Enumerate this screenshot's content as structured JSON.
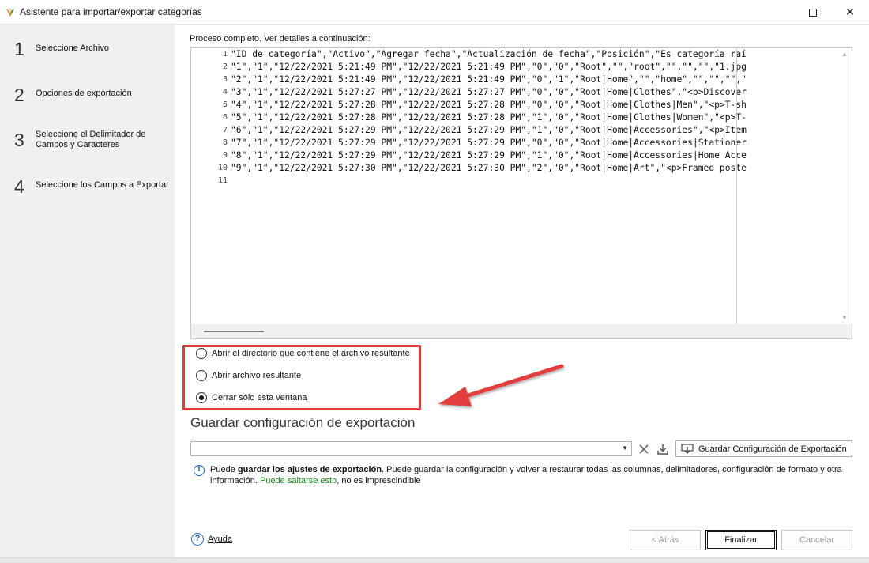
{
  "window": {
    "title": "Asistente para importar/exportar categorías",
    "maximize_glyph": "□",
    "close_glyph": "✕"
  },
  "steps": [
    {
      "num": "1",
      "label": "Seleccione Archivo"
    },
    {
      "num": "2",
      "label": "Opciones de exportación"
    },
    {
      "num": "3",
      "label": "Seleccione el Delimitador de Campos y Caracteres"
    },
    {
      "num": "4",
      "label": "Seleccione los Campos a Exportar"
    }
  ],
  "main": {
    "process_label": "Proceso completo. Ver detalles a continuación:",
    "line_numbers": [
      "1",
      "2",
      "3",
      "4",
      "5",
      "6",
      "7",
      "8",
      "9",
      "10",
      "11"
    ],
    "code_lines": [
      "\"ID de categoría\",\"Activo\",\"Agregar fecha\",\"Actualización de fecha\",\"Posición\",\"Es categoría raí",
      "\"1\",\"1\",\"12/22/2021 5:21:49 PM\",\"12/22/2021 5:21:49 PM\",\"0\",\"0\",\"Root\",\"\",\"root\",\"\",\"\",\"\",\"1.jpg",
      "\"2\",\"1\",\"12/22/2021 5:21:49 PM\",\"12/22/2021 5:21:49 PM\",\"0\",\"1\",\"Root|Home\",\"\",\"home\",\"\",\"\",\"\",\"",
      "\"3\",\"1\",\"12/22/2021 5:27:27 PM\",\"12/22/2021 5:27:27 PM\",\"0\",\"0\",\"Root|Home|Clothes\",\"<p>Discover",
      "\"4\",\"1\",\"12/22/2021 5:27:28 PM\",\"12/22/2021 5:27:28 PM\",\"0\",\"0\",\"Root|Home|Clothes|Men\",\"<p>T-sh",
      "\"5\",\"1\",\"12/22/2021 5:27:28 PM\",\"12/22/2021 5:27:28 PM\",\"1\",\"0\",\"Root|Home|Clothes|Women\",\"<p>T-",
      "\"6\",\"1\",\"12/22/2021 5:27:29 PM\",\"12/22/2021 5:27:29 PM\",\"1\",\"0\",\"Root|Home|Accessories\",\"<p>Item",
      "\"7\",\"1\",\"12/22/2021 5:27:29 PM\",\"12/22/2021 5:27:29 PM\",\"0\",\"0\",\"Root|Home|Accessories|Stationer",
      "\"8\",\"1\",\"12/22/2021 5:27:29 PM\",\"12/22/2021 5:27:29 PM\",\"1\",\"0\",\"Root|Home|Accessories|Home Acce",
      "\"9\",\"1\",\"12/22/2021 5:27:30 PM\",\"12/22/2021 5:27:30 PM\",\"2\",\"0\",\"Root|Home|Art\",\"<p>Framed poste",
      ""
    ],
    "options": [
      {
        "label": "Abrir el directorio que contiene el archivo resultante",
        "checked": false
      },
      {
        "label": "Abrir archivo resultante",
        "checked": false
      },
      {
        "label": "Cerrar sólo esta ventana",
        "checked": true
      }
    ],
    "save_config_title": "Guardar configuración de exportación",
    "save_config_value": "",
    "save_config_button": "Guardar Configuración de Exportación",
    "info": {
      "p1": "Puede ",
      "bold": "guardar los ajustes de exportación",
      "p2": ". Puede guardar la configuración y volver a restaurar todas las columnas, delimitadores, configuración de formato y otra",
      "p3": "información. ",
      "green": "Puede saltarse esto",
      "p4": ", no es imprescindible"
    },
    "help_label": "Ayuda",
    "back_button": "< Atrás",
    "finish_button": "Finalizar",
    "cancel_button": "Cancelar"
  },
  "colors": {
    "highlight_red": "#e43c3c",
    "info_blue": "#1e6fd0",
    "green_text": "#1a8a1a"
  }
}
